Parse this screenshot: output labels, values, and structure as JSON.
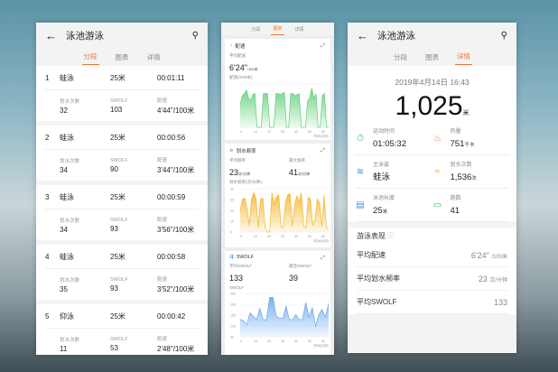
{
  "app": {
    "title": "泳池游泳",
    "tabs": [
      "分段",
      "图表",
      "详情"
    ]
  },
  "segments": {
    "labels": {
      "strokes": "划水次数",
      "swolf": "SWOLF",
      "pace": "配速"
    },
    "rows": [
      {
        "n": "1",
        "stroke": "蛙泳",
        "dist": "25米",
        "time": "00:01:11",
        "strokes": "32",
        "swolf": "103",
        "pace": "4'44\"/100米"
      },
      {
        "n": "2",
        "stroke": "蛙泳",
        "dist": "25米",
        "time": "00:00:56",
        "strokes": "34",
        "swolf": "90",
        "pace": "3'44\"/100米"
      },
      {
        "n": "3",
        "stroke": "蛙泳",
        "dist": "25米",
        "time": "00:00:59",
        "strokes": "34",
        "swolf": "93",
        "pace": "3'56\"/100米"
      },
      {
        "n": "4",
        "stroke": "蛙泳",
        "dist": "25米",
        "time": "00:00:58",
        "strokes": "35",
        "swolf": "93",
        "pace": "3'52\"/100米"
      },
      {
        "n": "5",
        "stroke": "仰泳",
        "dist": "25米",
        "time": "00:00:42",
        "strokes": "11",
        "swolf": "53",
        "pace": "2'48\"/100米"
      }
    ]
  },
  "charts": {
    "pace": {
      "title": "配速",
      "avg_label": "平均配速",
      "avg": "6'24\"",
      "unit": "/100米",
      "ylabel": "配速(/100米)"
    },
    "rate": {
      "title": "划水频率",
      "avg_label": "平均频率",
      "avg": "23",
      "max_label": "最大频率",
      "max": "41",
      "unit": "次/分钟",
      "ylabel": "划水频率(次/分钟)"
    },
    "swolf": {
      "title": "SWOLF",
      "avg_label": "平均SWOLF",
      "avg": "133",
      "best_label": "最佳SWOLF",
      "best": "39",
      "ylabel": "SWOLF"
    }
  },
  "chart_data": [
    {
      "type": "area",
      "title": "配速",
      "xlabel": "时间(分钟)",
      "x_ticks": [
        "0",
        "10",
        "20",
        "30",
        "40",
        "50",
        "60"
      ],
      "color": "#5fd07a",
      "values": [
        2,
        2.8,
        3,
        3.3,
        2.6,
        2.4,
        2.9,
        3,
        0,
        0,
        0,
        3,
        3,
        3,
        0,
        0,
        0,
        3,
        3,
        2.9,
        3,
        3.1,
        0,
        0,
        3,
        3,
        2.8,
        2.9,
        3,
        0,
        0,
        0,
        2.4,
        2.6,
        3.5,
        2.5,
        3,
        0,
        0,
        2.8,
        3,
        0,
        0
      ]
    },
    {
      "type": "area",
      "title": "划水频率",
      "xlabel": "时间(分钟)",
      "x_ticks": [
        "0",
        "10",
        "20",
        "30",
        "40",
        "50",
        "60"
      ],
      "y_ticks": [
        "0",
        "10",
        "20",
        "30",
        "40"
      ],
      "color": "#f5b731",
      "values": [
        20,
        30,
        31,
        22,
        6,
        30,
        36,
        30,
        4,
        30,
        31,
        4,
        0,
        0,
        36,
        26,
        32,
        34,
        5,
        4,
        28,
        34,
        35,
        5,
        25,
        33,
        28,
        36,
        5,
        4,
        32,
        30,
        6,
        12,
        30,
        27,
        5,
        34,
        4,
        2
      ]
    },
    {
      "type": "area",
      "title": "SWOLF",
      "xlabel": "时间(分钟)",
      "x_ticks": [
        "0",
        "10",
        "20",
        "30",
        "40",
        "50",
        "60"
      ],
      "y_ticks": [
        "50",
        "100",
        "150",
        "200",
        "250"
      ],
      "color": "#6aa9ec",
      "values": [
        100,
        95,
        70,
        140,
        120,
        100,
        165,
        100,
        98,
        230,
        230,
        120,
        110,
        105,
        180,
        100,
        100,
        130,
        100,
        100,
        200,
        115,
        170,
        60,
        130,
        160,
        115,
        195
      ]
    }
  ],
  "detail": {
    "date": "2019年4月14日 16:43",
    "distance": "1,025",
    "distance_unit": "米",
    "stats": [
      {
        "label": "运动时间",
        "value": "01:05:32",
        "unit": "",
        "icon": "stopwatch-icon",
        "glyph": "⏱",
        "color": "#3ec07a"
      },
      {
        "label": "热量",
        "value": "751",
        "unit": "千卡",
        "icon": "flame-icon",
        "glyph": "♨",
        "color": "#f06a4a"
      },
      {
        "label": "主泳姿",
        "value": "蛙泳",
        "unit": "",
        "icon": "swim-stroke-icon",
        "glyph": "≋",
        "color": "#3a8de0"
      },
      {
        "label": "划水次数",
        "value": "1,536",
        "unit": "次",
        "icon": "swimmer-icon",
        "glyph": "≈",
        "color": "#f0a030"
      },
      {
        "label": "泳池长度",
        "value": "25",
        "unit": "米",
        "icon": "pool-icon",
        "glyph": "▤",
        "color": "#4a90e2"
      },
      {
        "label": "趟数",
        "value": "41",
        "unit": "",
        "icon": "laps-icon",
        "glyph": "▭",
        "color": "#2fbf5a"
      }
    ],
    "perf_title": "游泳表现",
    "perf": [
      {
        "label": "平均配速",
        "value": "6'24\"",
        "unit": "/100米"
      },
      {
        "label": "平均划水频率",
        "value": "23",
        "unit": "次/分钟"
      },
      {
        "label": "平均SWOLF",
        "value": "133",
        "unit": ""
      }
    ]
  }
}
